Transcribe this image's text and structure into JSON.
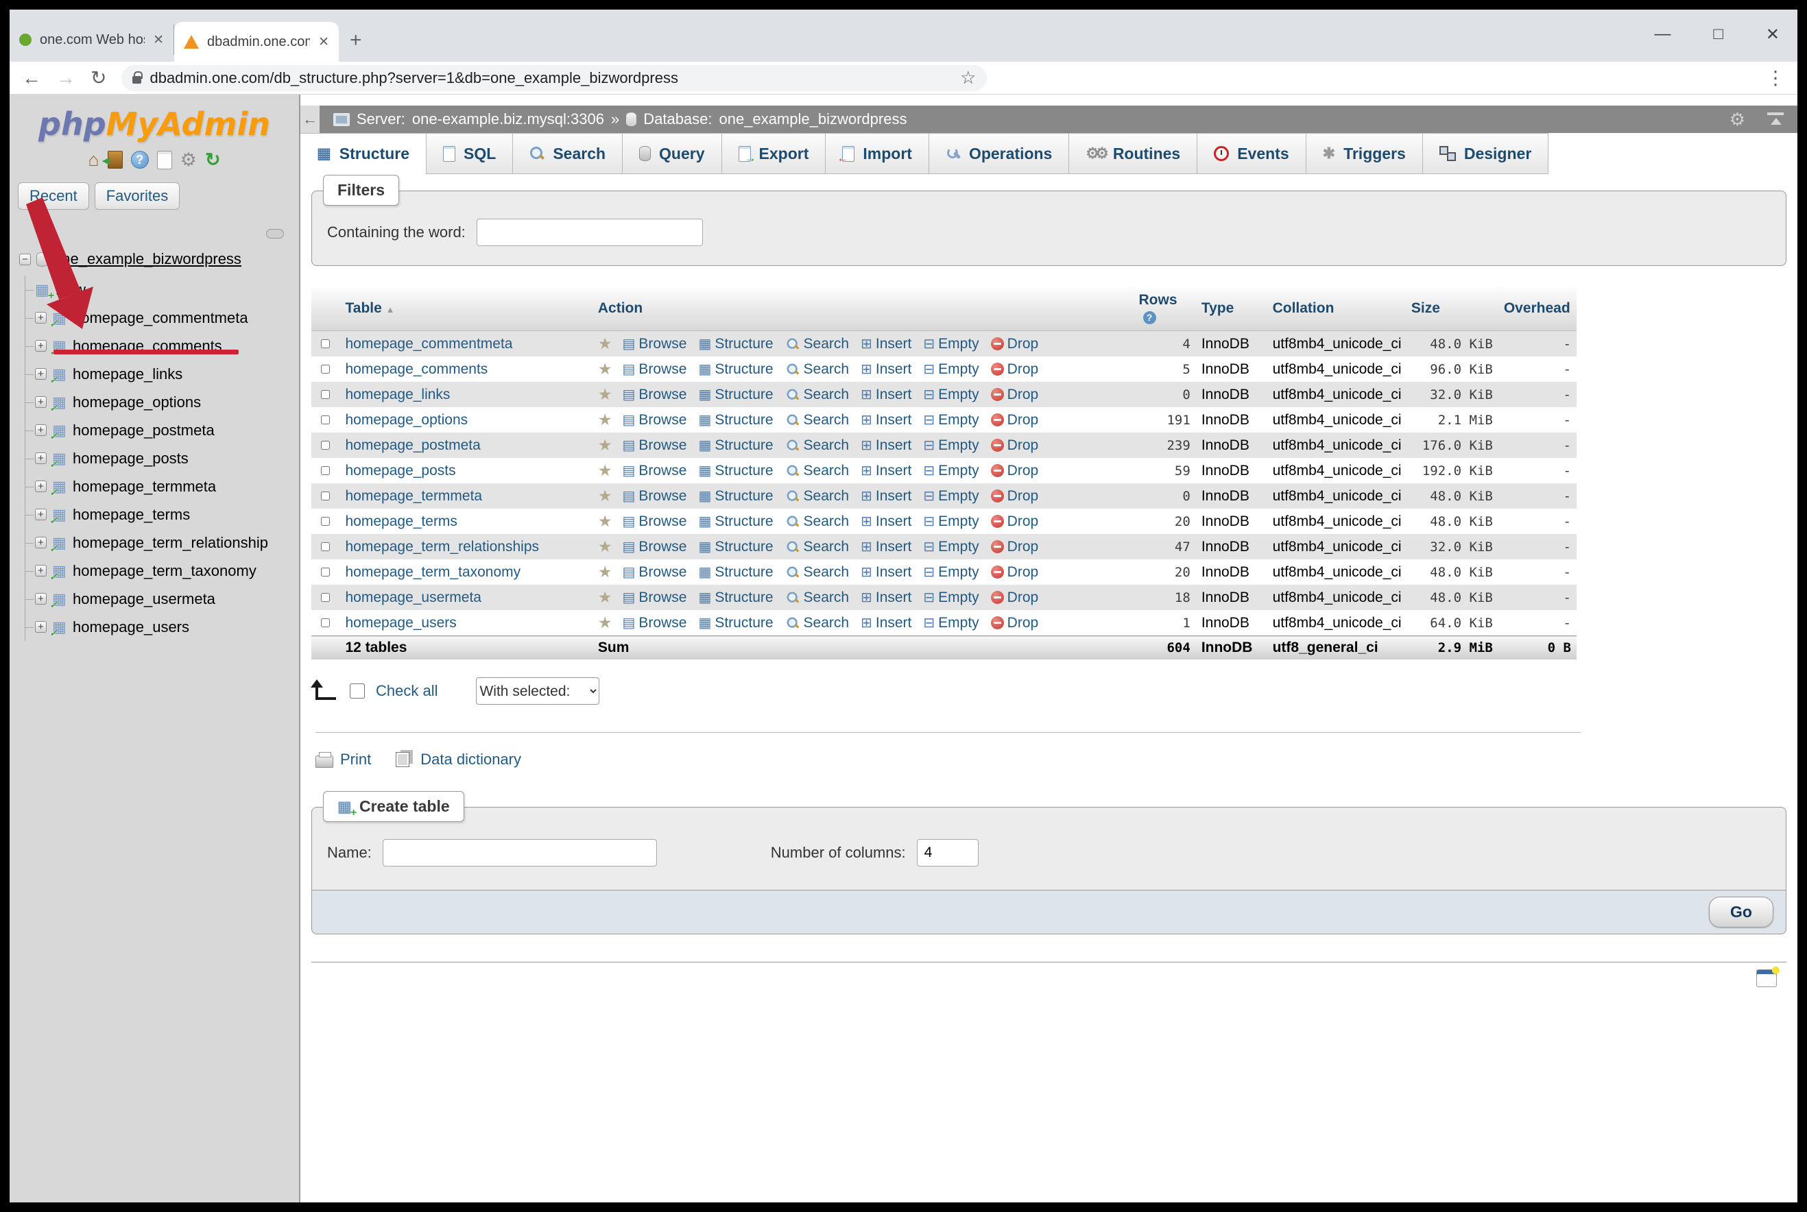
{
  "browser": {
    "tabs": [
      {
        "title": "one.com Web hosting  -  Domain"
      },
      {
        "title": "dbadmin.one.com / one-example"
      }
    ],
    "url": "dbadmin.one.com/db_structure.php?server=1&db=one_example_bizwordpress"
  },
  "icons": {
    "star": "★",
    "star_outline": "☆",
    "browse": "▤",
    "structure": "▦",
    "insert": "⊞",
    "empty": "⊟",
    "plus": "+",
    "minus": "−",
    "check": "✓",
    "sort_asc": "▲",
    "help_q": "?",
    "home": "⌂",
    "gear": "⚙",
    "refresh": "↻",
    "back": "←",
    "forward": "→",
    "reload": "↻",
    "menu_dots": "⋮",
    "close": "✕",
    "new_tab": "+",
    "win_min": "—",
    "win_max": "□",
    "win_close": "✕",
    "crumb_sep": "»",
    "crumb_back": "←",
    "gears": "⚙⚙",
    "trigger": "✱"
  },
  "sidebar": {
    "logo_php": "php",
    "logo_myadmin": "MyAdmin",
    "buttons": {
      "recent": "Recent",
      "favorites": "Favorites"
    },
    "tree": {
      "database": "one_example_bizwordpress",
      "new_item": "New",
      "tables": [
        "homepage_commentmeta",
        "homepage_comments",
        "homepage_links",
        "homepage_options",
        "homepage_postmeta",
        "homepage_posts",
        "homepage_termmeta",
        "homepage_terms",
        "homepage_term_relationship",
        "homepage_term_taxonomy",
        "homepage_usermeta",
        "homepage_users"
      ]
    }
  },
  "breadcrumb": {
    "server_label": "Server:",
    "server": "one-example.biz.mysql:3306",
    "db_label": "Database:",
    "db": "one_example_bizwordpress"
  },
  "nav_tabs": [
    {
      "label": "Structure"
    },
    {
      "label": "SQL"
    },
    {
      "label": "Search"
    },
    {
      "label": "Query"
    },
    {
      "label": "Export"
    },
    {
      "label": "Import"
    },
    {
      "label": "Operations"
    },
    {
      "label": "Routines"
    },
    {
      "label": "Events"
    },
    {
      "label": "Triggers"
    },
    {
      "label": "Designer"
    }
  ],
  "filters": {
    "legend": "Filters",
    "containing_label": "Containing the word:",
    "value": ""
  },
  "table": {
    "headers": {
      "name": "Table",
      "action": "Action",
      "rows": "Rows",
      "type": "Type",
      "collation": "Collation",
      "size": "Size",
      "overhead": "Overhead"
    },
    "action_labels": [
      "Browse",
      "Structure",
      "Search",
      "Insert",
      "Empty",
      "Drop"
    ],
    "rows": [
      {
        "name": "homepage_commentmeta",
        "rows": "4",
        "type": "InnoDB",
        "collation": "utf8mb4_unicode_ci",
        "size": "48.0 KiB",
        "overhead": "-"
      },
      {
        "name": "homepage_comments",
        "rows": "5",
        "type": "InnoDB",
        "collation": "utf8mb4_unicode_ci",
        "size": "96.0 KiB",
        "overhead": "-"
      },
      {
        "name": "homepage_links",
        "rows": "0",
        "type": "InnoDB",
        "collation": "utf8mb4_unicode_ci",
        "size": "32.0 KiB",
        "overhead": "-"
      },
      {
        "name": "homepage_options",
        "rows": "191",
        "type": "InnoDB",
        "collation": "utf8mb4_unicode_ci",
        "size": "2.1 MiB",
        "overhead": "-"
      },
      {
        "name": "homepage_postmeta",
        "rows": "239",
        "type": "InnoDB",
        "collation": "utf8mb4_unicode_ci",
        "size": "176.0 KiB",
        "overhead": "-"
      },
      {
        "name": "homepage_posts",
        "rows": "59",
        "type": "InnoDB",
        "collation": "utf8mb4_unicode_ci",
        "size": "192.0 KiB",
        "overhead": "-"
      },
      {
        "name": "homepage_termmeta",
        "rows": "0",
        "type": "InnoDB",
        "collation": "utf8mb4_unicode_ci",
        "size": "48.0 KiB",
        "overhead": "-"
      },
      {
        "name": "homepage_terms",
        "rows": "20",
        "type": "InnoDB",
        "collation": "utf8mb4_unicode_ci",
        "size": "48.0 KiB",
        "overhead": "-"
      },
      {
        "name": "homepage_term_relationships",
        "rows": "47",
        "type": "InnoDB",
        "collation": "utf8mb4_unicode_ci",
        "size": "32.0 KiB",
        "overhead": "-"
      },
      {
        "name": "homepage_term_taxonomy",
        "rows": "20",
        "type": "InnoDB",
        "collation": "utf8mb4_unicode_ci",
        "size": "48.0 KiB",
        "overhead": "-"
      },
      {
        "name": "homepage_usermeta",
        "rows": "18",
        "type": "InnoDB",
        "collation": "utf8mb4_unicode_ci",
        "size": "48.0 KiB",
        "overhead": "-"
      },
      {
        "name": "homepage_users",
        "rows": "1",
        "type": "InnoDB",
        "collation": "utf8mb4_unicode_ci",
        "size": "64.0 KiB",
        "overhead": "-"
      }
    ],
    "sum": {
      "tables": "12 tables",
      "label": "Sum",
      "rows": "604",
      "type": "InnoDB",
      "collation": "utf8_general_ci",
      "size": "2.9 MiB",
      "overhead": "0 B"
    }
  },
  "footer_controls": {
    "check_all": "Check all",
    "with_selected": "With selected:"
  },
  "links": {
    "print": "Print",
    "data_dictionary": "Data dictionary"
  },
  "create_table": {
    "legend": "Create table",
    "name_label": "Name:",
    "name_value": "",
    "columns_label": "Number of columns:",
    "columns_value": "4",
    "go": "Go"
  }
}
